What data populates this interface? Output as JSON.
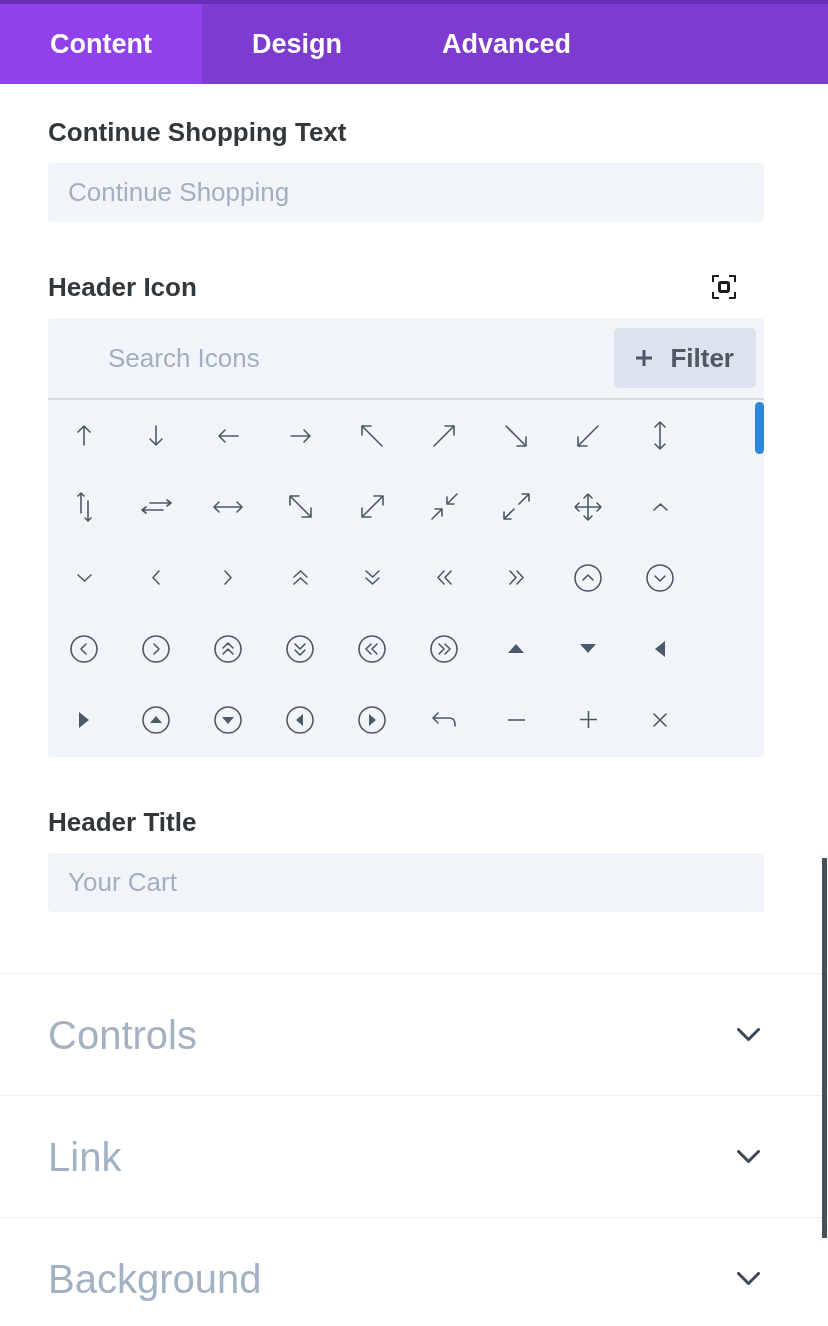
{
  "tabs": [
    {
      "label": "Content",
      "selected": true
    },
    {
      "label": "Design",
      "selected": false
    },
    {
      "label": "Advanced",
      "selected": false
    }
  ],
  "settings": [
    {
      "kind": "text",
      "label": "Continue Shopping Text",
      "placeholder": "Continue Shopping"
    },
    {
      "kind": "iconpicker",
      "label": "Header Icon",
      "search": {
        "placeholder": "Search Icons"
      },
      "filter_button": "Filter",
      "icons": [
        {
          "kind": "arrow-up"
        },
        {
          "kind": "arrow-down"
        },
        {
          "kind": "arrow-left"
        },
        {
          "kind": "arrow-right"
        },
        {
          "kind": "arrow-up-left"
        },
        {
          "kind": "arrow-up-right"
        },
        {
          "kind": "arrow-down-right"
        },
        {
          "kind": "arrow-down-left"
        },
        {
          "kind": "arrow-up-down"
        },
        {
          "kind": "arrows-up-down-pair"
        },
        {
          "kind": "arrows-left-right-pair"
        },
        {
          "kind": "arrow-left-right"
        },
        {
          "kind": "diagonal-arrow-nwse"
        },
        {
          "kind": "diagonal-arrow-nesw"
        },
        {
          "kind": "collapse-arrows"
        },
        {
          "kind": "expand-arrows"
        },
        {
          "kind": "move-arrows"
        },
        {
          "kind": "chevron-up"
        },
        {
          "kind": "chevron-down"
        },
        {
          "kind": "chevron-left"
        },
        {
          "kind": "chevron-right"
        },
        {
          "kind": "double-chevron-up"
        },
        {
          "kind": "double-chevron-down"
        },
        {
          "kind": "double-chevron-left"
        },
        {
          "kind": "double-chevron-right"
        },
        {
          "kind": "circled-chevron-up"
        },
        {
          "kind": "circled-chevron-down"
        },
        {
          "kind": "circled-chevron-left"
        },
        {
          "kind": "circled-chevron-right"
        },
        {
          "kind": "circled-double-chevron-up"
        },
        {
          "kind": "circled-double-chevron-down"
        },
        {
          "kind": "circled-double-chevron-left"
        },
        {
          "kind": "circled-double-chevron-right"
        },
        {
          "kind": "triangle-up"
        },
        {
          "kind": "triangle-down"
        },
        {
          "kind": "triangle-left"
        },
        {
          "kind": "triangle-right"
        },
        {
          "kind": "circled-triangle-up"
        },
        {
          "kind": "circled-triangle-down"
        },
        {
          "kind": "circled-triangle-left"
        },
        {
          "kind": "circled-triangle-right"
        },
        {
          "kind": "reply-arrow"
        },
        {
          "kind": "minus"
        },
        {
          "kind": "plus"
        },
        {
          "kind": "close"
        }
      ]
    },
    {
      "kind": "text",
      "label": "Header Title",
      "placeholder": "Your Cart"
    }
  ],
  "sections": [
    {
      "title": "Controls",
      "expanded": false
    },
    {
      "title": "Link",
      "expanded": false
    },
    {
      "title": "Background",
      "expanded": false
    }
  ]
}
